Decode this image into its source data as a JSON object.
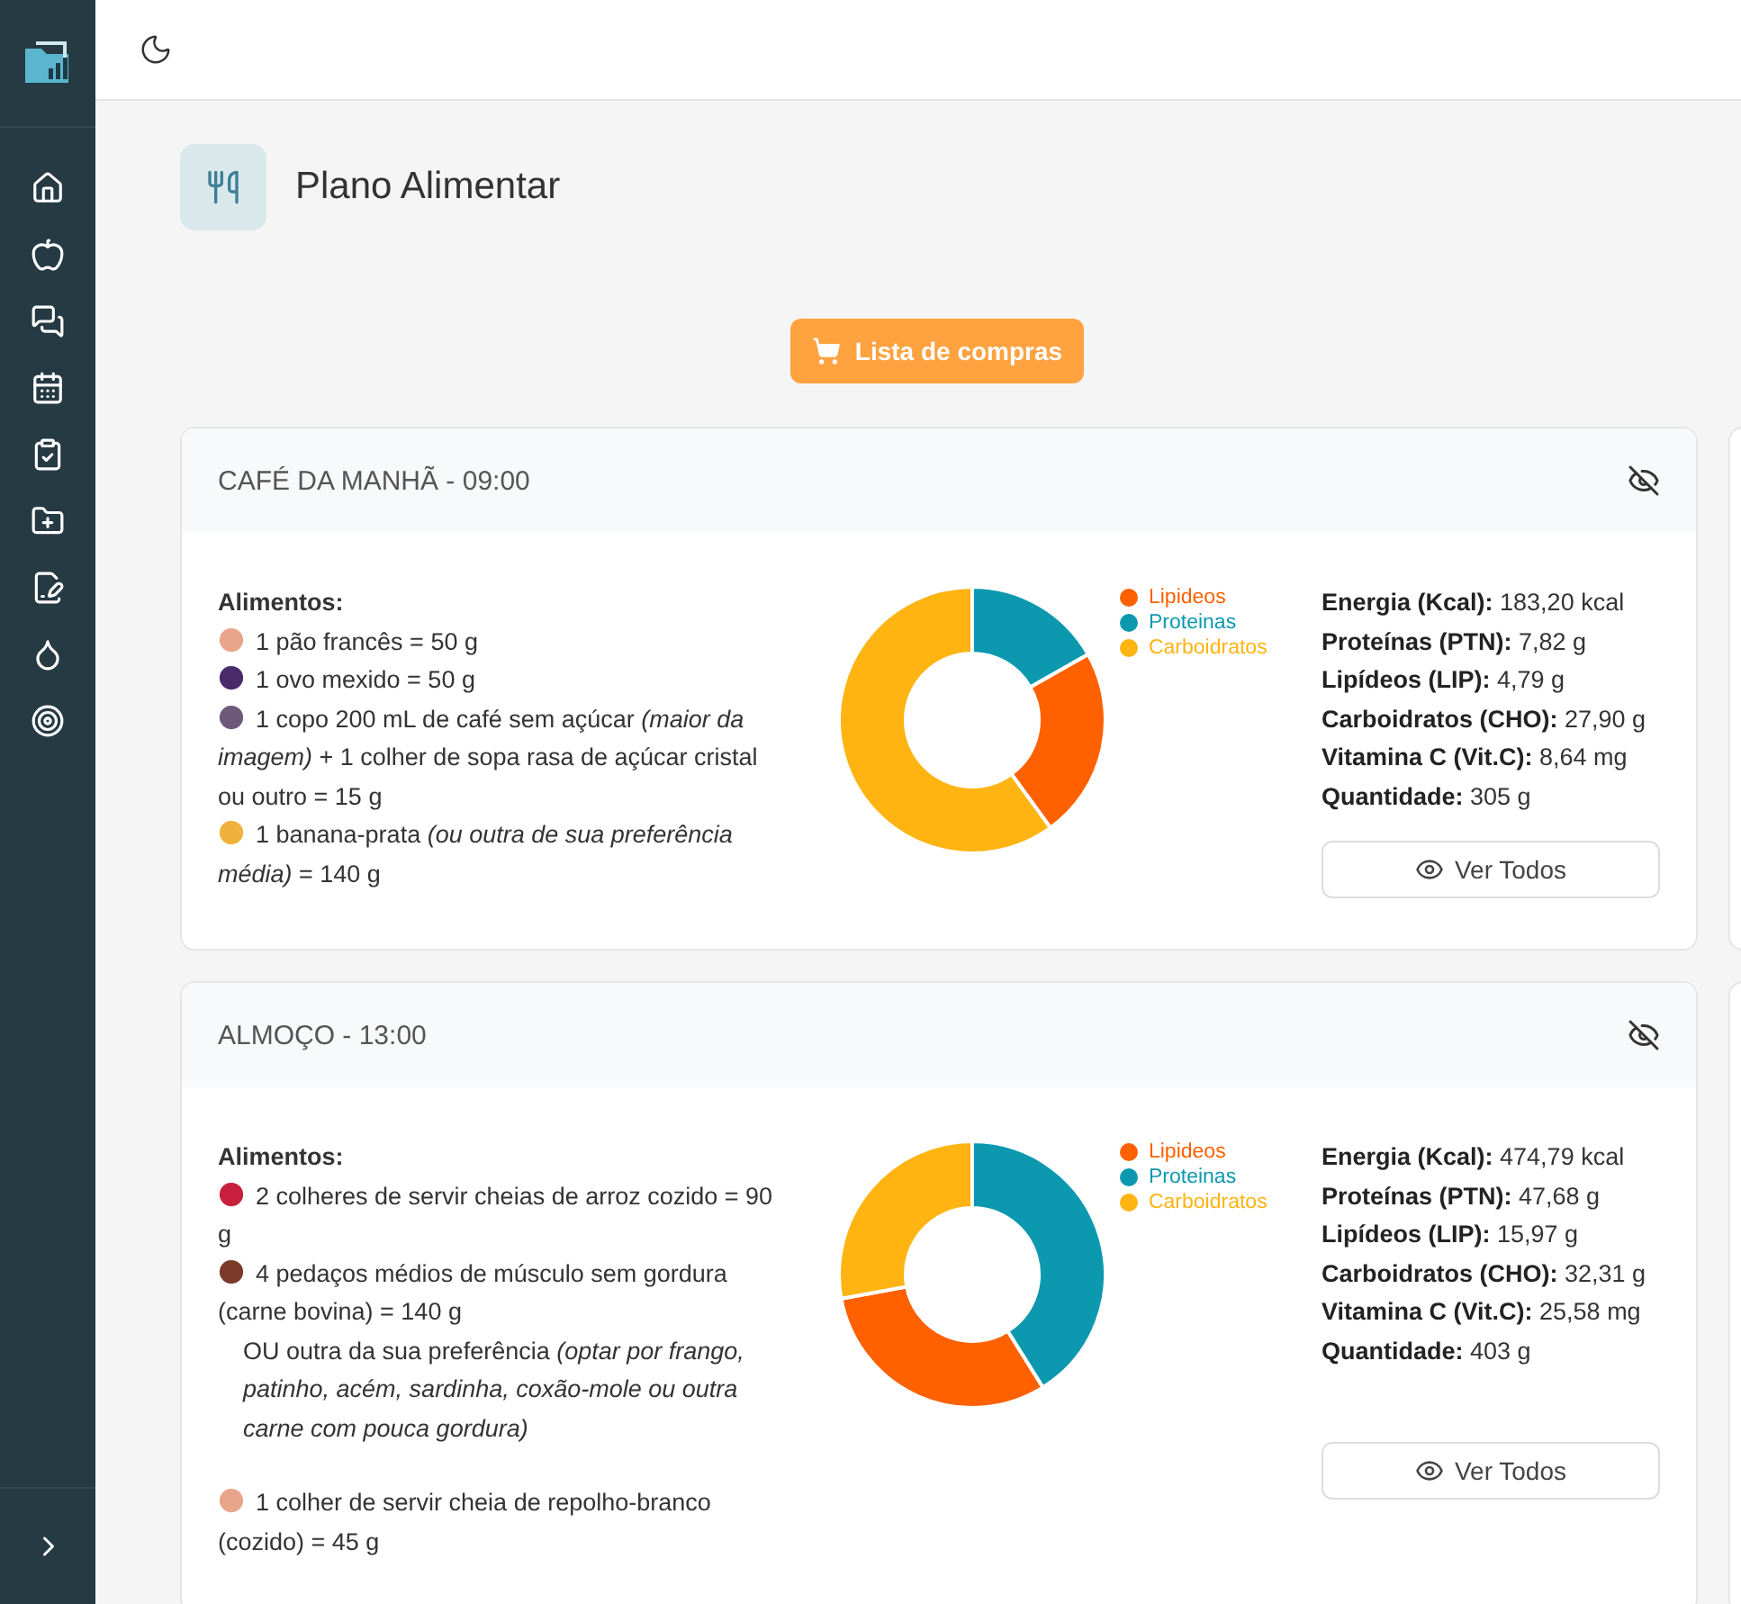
{
  "header": {
    "title": "Plano Alimentar"
  },
  "shopping_button": {
    "label": "Lista de compras"
  },
  "meals": [
    {
      "title": "CAFÉ DA MANHÃ - 09:00",
      "foods_label": "Alimentos:",
      "foods": [
        {
          "kind": "food",
          "text": "1 pão francês = 50 g"
        },
        {
          "kind": "food",
          "text": "1 ovo mexido = 50 g"
        },
        {
          "kind": "food",
          "text": "1 copo 200 mL de café sem açúcar *(maior da imagem)* +  1 colher de sopa rasa de açúcar cristal ou outro = 15 g"
        },
        {
          "kind": "food",
          "text": "1 banana-prata *(ou outra de sua preferência média)* = 140 g"
        }
      ],
      "chart_data": {
        "type": "donut",
        "categories": [
          "Lipideos",
          "Proteinas",
          "Carboidratos"
        ],
        "values": [
          23.2,
          16.8,
          60.0
        ],
        "legend": "right"
      },
      "stats": [
        "**Energia (Kcal):** 183,20 kcal",
        "**Proteínas (PTN):** 7,82 g",
        "**Lipídeos (LIP):** 4,79 g",
        "**Carboidratos (CHO):** 27,90 g",
        "**Vitamina C (Vit.C):** 8,64 mg",
        "**Quantidade:** 305 g"
      ],
      "view_button": "Ver Todos"
    },
    {
      "title": "ALMOÇO - 13:00",
      "foods_label": "Alimentos:",
      "foods": [
        {
          "kind": "food",
          "text": "2 colheres de servir cheias de arroz cozido = 90 g"
        },
        {
          "kind": "food",
          "text": "4 pedaços médios de músculo sem gordura (carne bovina) = 140 g"
        },
        {
          "kind": "note",
          "text": "OU outra da sua preferência *(optar por frango, patinho, acém, sardinha, coxão-mole ou outra carne com pouca gordura)*"
        },
        {
          "kind": "food",
          "text": "1 colher de servir cheia de repolho-branco (cozido) = 45 g"
        }
      ],
      "chart_data": {
        "type": "donut",
        "categories": [
          "Lipideos",
          "Proteinas",
          "Carboidratos"
        ],
        "values": [
          31.0,
          41.1,
          27.9
        ],
        "legend": "right"
      },
      "stats": [
        "**Energia (Kcal):** 474,79 kcal",
        "**Proteínas (PTN):** 47,68 g",
        "**Lipídeos (LIP):** 15,97 g",
        "**Carboidratos (CHO):** 32,31 g",
        "**Vitamina C (Vit.C):** 25,58 mg",
        "**Quantidade:** 403 g"
      ],
      "view_button": "Ver Todos"
    }
  ]
}
